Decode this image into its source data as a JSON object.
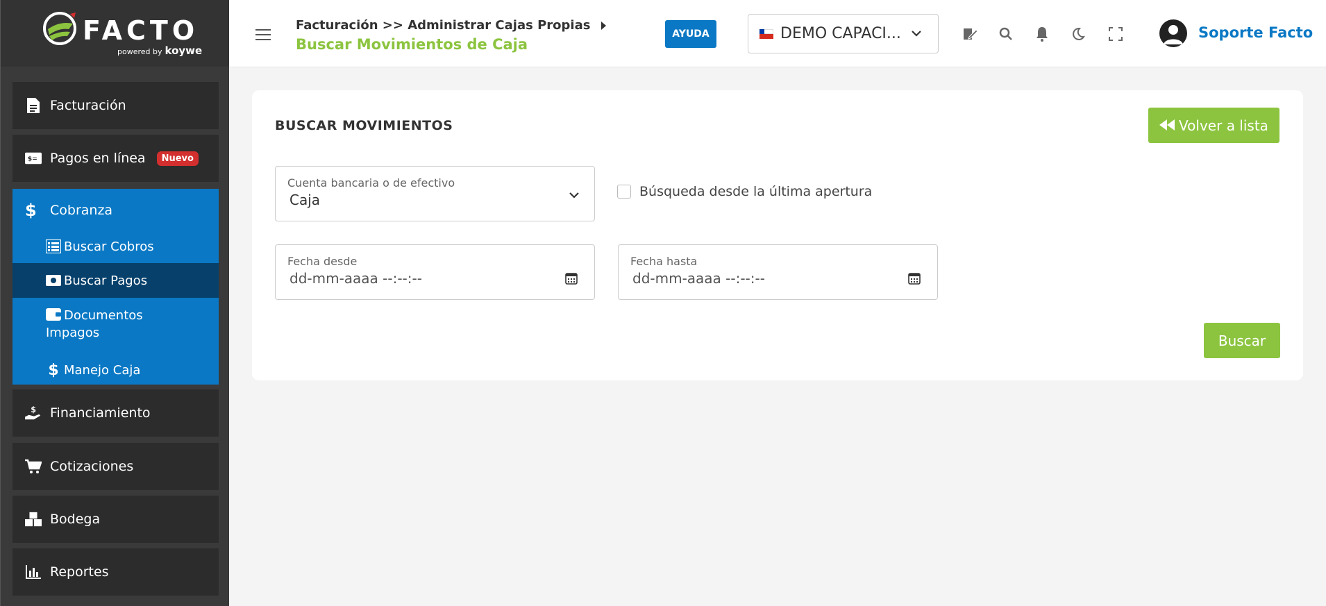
{
  "brand": {
    "name": "FACTO",
    "powered_by": "powered by",
    "partner": "koywe"
  },
  "sidebar": {
    "items": [
      {
        "label": "Facturación",
        "icon": "file-icon"
      },
      {
        "label": "Pagos en línea",
        "icon": "money-bill-icon",
        "badge": "Nuevo"
      },
      {
        "label": "Financiamiento",
        "icon": "hand-holding-dollar-icon"
      },
      {
        "label": "Cotizaciones",
        "icon": "cart-icon"
      },
      {
        "label": "Bodega",
        "icon": "boxes-icon"
      },
      {
        "label": "Reportes",
        "icon": "bar-chart-icon"
      }
    ],
    "group": {
      "label": "Cobranza",
      "icon": "dollar-icon",
      "children": [
        {
          "label": "Buscar Cobros",
          "icon": "list-icon"
        },
        {
          "label": "Buscar Pagos",
          "icon": "money-icon",
          "active": true
        },
        {
          "label": "Documentos Impagos",
          "icon": "wallet-icon"
        },
        {
          "label": "Manejo Caja",
          "icon": "dollar-icon"
        }
      ]
    }
  },
  "header": {
    "breadcrumb": "Facturación >> Administrar Cajas Propias",
    "page_title": "Buscar Movimientos de Caja",
    "help_label": "AYUDA",
    "company": "DEMO CAPACI...",
    "user_name": "Soporte Facto"
  },
  "form": {
    "title": "BUSCAR MOVIMIENTOS",
    "back_label": "Volver a lista",
    "account_label": "Cuenta bancaria o de efectivo",
    "account_value": "Caja",
    "since_last_open_label": "Búsqueda desde la última apertura",
    "date_from_label": "Fecha desde",
    "date_from_placeholder": "dd-mm-aaaa --:--:--",
    "date_to_label": "Fecha hasta",
    "date_to_placeholder": "dd-mm-aaaa --:--:--",
    "search_label": "Buscar"
  },
  "colors": {
    "primary_blue": "#0a78c4",
    "accent_green": "#8cc43f",
    "sidebar_dark": "#2c2c2c",
    "active_sub": "#06406b",
    "badge_red": "#d32f2f"
  }
}
